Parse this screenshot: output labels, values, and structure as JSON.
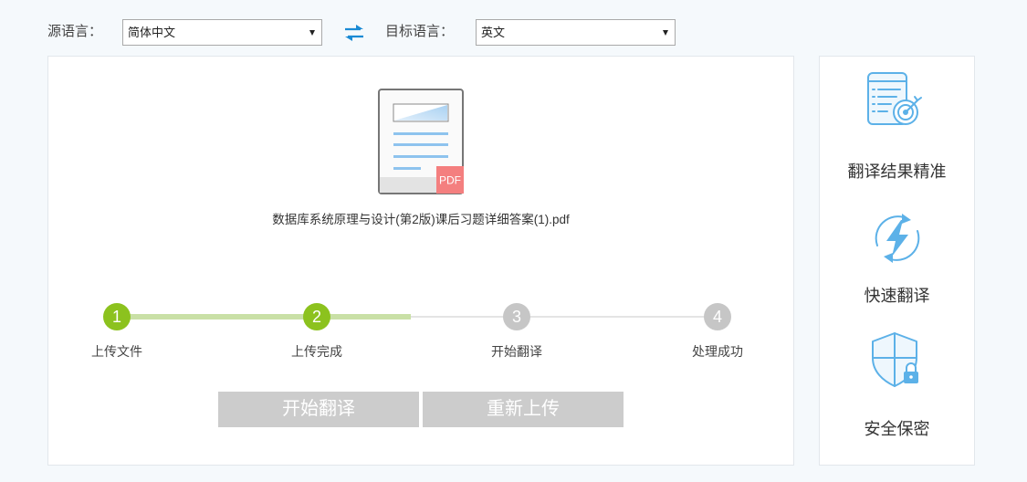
{
  "toolbar": {
    "source_label": "源语言：",
    "source_value": "简体中文",
    "target_label": "目标语言：",
    "target_value": "英文"
  },
  "file": {
    "badge": "PDF",
    "name": "数据库系统原理与设计(第2版)课后习题详细答案(1).pdf"
  },
  "steps": [
    {
      "number": "1",
      "label": "上传文件",
      "completed": true
    },
    {
      "number": "2",
      "label": "上传完成",
      "completed": true
    },
    {
      "number": "3",
      "label": "开始翻译",
      "completed": false
    },
    {
      "number": "4",
      "label": "处理成功",
      "completed": false
    }
  ],
  "progress": {
    "fill_fraction": 0.49
  },
  "actions": {
    "start_label": "开始翻译",
    "reupload_label": "重新上传"
  },
  "features": [
    {
      "icon": "target-document-icon",
      "label": "翻译结果精准"
    },
    {
      "icon": "lightning-refresh-icon",
      "label": "快速翻译"
    },
    {
      "icon": "shield-lock-icon",
      "label": "安全保密"
    }
  ],
  "icons": {
    "swap": "swap-arrows-icon",
    "file": "pdf-file-icon",
    "dropdown": "dropdown-arrow-icon"
  },
  "colors": {
    "accent_green": "#8cc21e",
    "track_green": "#c9e0a6",
    "track_gray": "#e4e4e4",
    "step_gray": "#c6c6c6",
    "button_gray": "#cccccc",
    "icon_blue": "#5cb1e8",
    "swap_blue": "#1a8ad4",
    "pdf_red": "#f47f7f"
  }
}
